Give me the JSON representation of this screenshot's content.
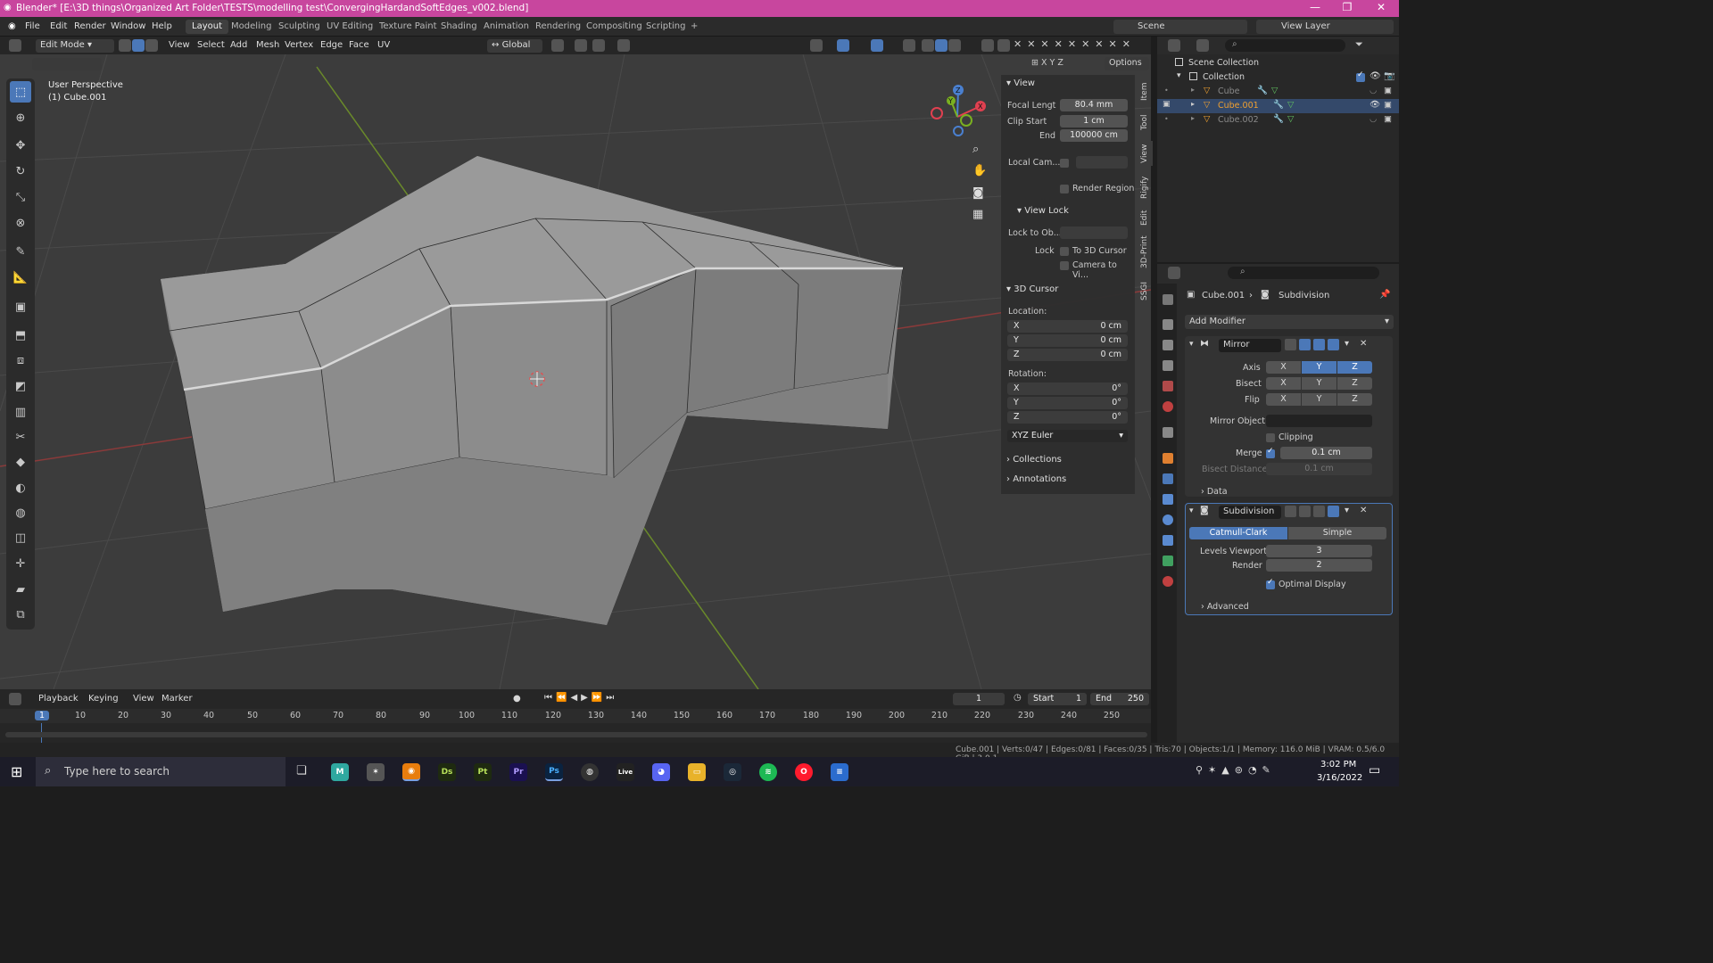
{
  "titlebar": {
    "title": "Blender* [E:\\3D things\\Organized Art Folder\\TESTS\\modelling test\\ConvergingHardandSoftEdges_v002.blend]",
    "minimize": "—",
    "maximize": "❐",
    "close": "✕"
  },
  "menu": {
    "items": [
      "File",
      "Edit",
      "Render",
      "Window",
      "Help"
    ]
  },
  "workspaces": [
    "Layout",
    "Modeling",
    "Sculpting",
    "UV Editing",
    "Texture Paint",
    "Shading",
    "Animation",
    "Rendering",
    "Compositing",
    "Scripting"
  ],
  "workspace_add": "+",
  "scene": {
    "label": "Scene",
    "view_layer": "View Layer"
  },
  "header3d": {
    "mode": "Edit Mode",
    "menus": [
      "View",
      "Select",
      "Add",
      "Mesh",
      "Vertex",
      "Edge",
      "Face",
      "UV"
    ],
    "orientation": "Global",
    "options": "Options",
    "axes": [
      "X",
      "Y",
      "Z"
    ]
  },
  "viewport": {
    "perspective": "User Perspective",
    "object": "(1) Cube.001",
    "gizmo": {
      "x": "X",
      "y": "Y",
      "z": "Z"
    }
  },
  "npanel": {
    "tabs": [
      "Item",
      "Tool",
      "View",
      "Rigify",
      "Edit",
      "3D-Print",
      "SSGI"
    ],
    "view": {
      "title": "View",
      "focal_label": "Focal Lengt",
      "focal_value": "80.4 mm",
      "clip_start_label": "Clip Start",
      "clip_start_value": "1 cm",
      "end_label": "End",
      "end_value": "100000 cm",
      "local_cam": "Local Cam...",
      "render_region": "Render Region"
    },
    "view_lock": {
      "title": "View Lock",
      "lock_to_ob": "Lock to Ob...",
      "lock": "Lock",
      "to_3d_cursor": "To 3D Cursor",
      "camera_to_view": "Camera to Vi..."
    },
    "cursor": {
      "title": "3D Cursor",
      "location": "Location:",
      "loc": [
        {
          "axis": "X",
          "value": "0 cm"
        },
        {
          "axis": "Y",
          "value": "0 cm"
        },
        {
          "axis": "Z",
          "value": "0 cm"
        }
      ],
      "rotation": "Rotation:",
      "rot": [
        {
          "axis": "X",
          "value": "0°"
        },
        {
          "axis": "Y",
          "value": "0°"
        },
        {
          "axis": "Z",
          "value": "0°"
        }
      ],
      "mode": "XYZ Euler"
    },
    "collections": "Collections",
    "annotations": "Annotations"
  },
  "outliner": {
    "scene_collection": "Scene Collection",
    "collection": "Collection",
    "objects": [
      "Cube",
      "Cube.001",
      "Cube.002"
    ]
  },
  "properties": {
    "breadcrumb_object": "Cube.001",
    "breadcrumb_mod": "Subdivision",
    "add_modifier": "Add Modifier",
    "mirror": {
      "name": "Mirror",
      "axis": "Axis",
      "bisect": "Bisect",
      "flip": "Flip",
      "xyz": [
        "X",
        "Y",
        "Z"
      ],
      "mirror_object": "Mirror Object",
      "clipping": "Clipping",
      "merge": "Merge",
      "merge_value": "0.1 cm",
      "bisect_distance": "Bisect Distance",
      "bisect_distance_value": "0.1 cm",
      "data": "Data"
    },
    "subdivision": {
      "name": "Subdivision",
      "catmull": "Catmull-Clark",
      "simple": "Simple",
      "levels_viewport": "Levels Viewport",
      "levels_viewport_value": "3",
      "render": "Render",
      "render_value": "2",
      "optimal_display": "Optimal Display",
      "advanced": "Advanced"
    }
  },
  "timeline": {
    "menus": [
      "Playback",
      "Keying",
      "View",
      "Marker"
    ],
    "current_frame": "1",
    "start_label": "Start",
    "start": "1",
    "end_label": "End",
    "end": "250",
    "ticks": [
      "1",
      "10",
      "20",
      "30",
      "40",
      "50",
      "60",
      "70",
      "80",
      "90",
      "100",
      "110",
      "120",
      "130",
      "140",
      "150",
      "160",
      "170",
      "180",
      "190",
      "200",
      "210",
      "220",
      "230",
      "240",
      "250"
    ]
  },
  "statusbar": {
    "stats": "Cube.001 | Verts:0/47 | Edges:0/81 | Faces:0/35 | Tris:70 | Objects:1/1 | Memory: 116.0 MiB | VRAM: 0.5/6.0 GiB | 3.0.1"
  },
  "taskbar": {
    "search_placeholder": "Type here to search",
    "time": "3:02 PM",
    "date": "3/16/2022",
    "apps": [
      "M",
      "Ds",
      "Pt",
      "Pr",
      "Ps",
      "Live"
    ]
  },
  "colors": {
    "accent": "#4b78b8",
    "titlebar": "#c8469e",
    "selected_object": "#f0a030"
  }
}
